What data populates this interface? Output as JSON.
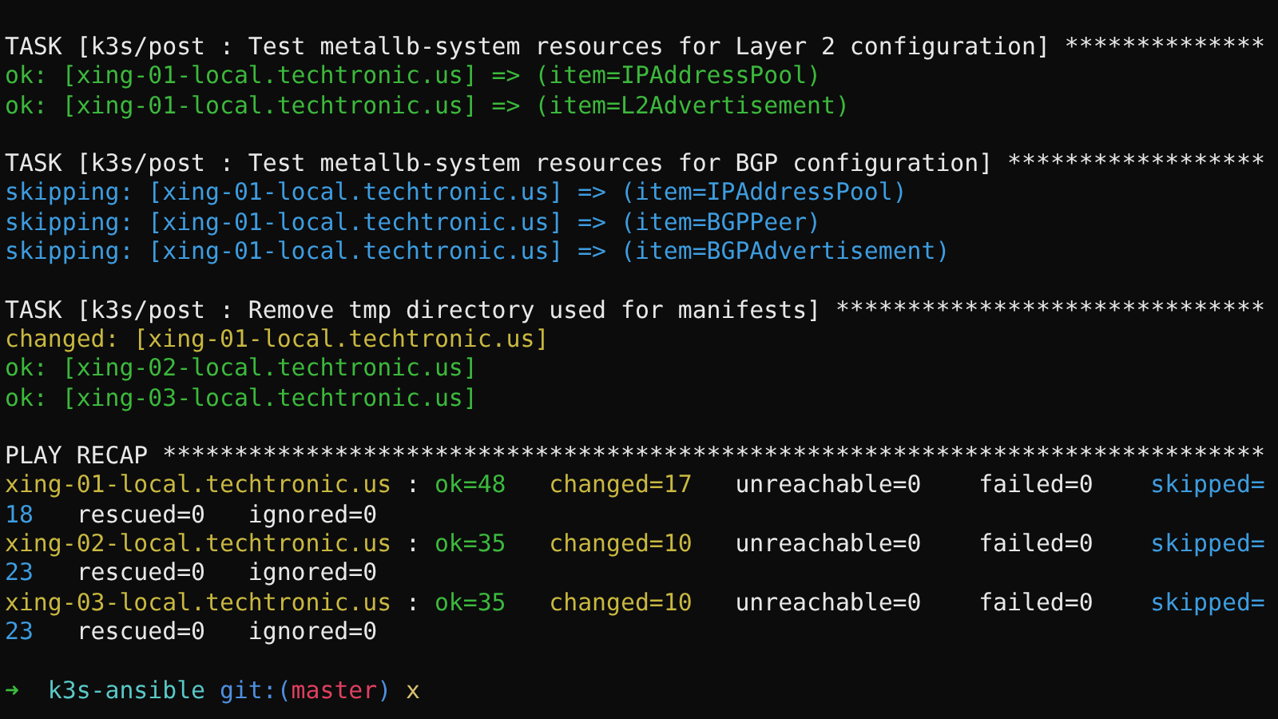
{
  "blocks": [
    {
      "lines": [
        {
          "kind": "text",
          "segments": [
            {
              "kind": "plain",
              "text": "TASK [k3s/post : Test metallb-system resources for Layer 2 configuration] **************"
            }
          ]
        },
        {
          "kind": "text",
          "segments": [
            {
              "kind": "ok",
              "text": "ok: [xing-01-local.techtronic.us] => (item=IPAddressPool)"
            }
          ]
        },
        {
          "kind": "text",
          "segments": [
            {
              "kind": "ok",
              "text": "ok: [xing-01-local.techtronic.us] => (item=L2Advertisement)"
            }
          ]
        }
      ]
    },
    {
      "lines": [
        {
          "kind": "text",
          "segments": [
            {
              "kind": "plain",
              "text": "TASK [k3s/post : Test metallb-system resources for BGP configuration] ******************"
            }
          ]
        },
        {
          "kind": "text",
          "segments": [
            {
              "kind": "skipping",
              "text": "skipping: [xing-01-local.techtronic.us] => (item=IPAddressPool)"
            }
          ]
        },
        {
          "kind": "text",
          "segments": [
            {
              "kind": "skipping",
              "text": "skipping: [xing-01-local.techtronic.us] => (item=BGPPeer)"
            }
          ]
        },
        {
          "kind": "text",
          "segments": [
            {
              "kind": "skipping",
              "text": "skipping: [xing-01-local.techtronic.us] => (item=BGPAdvertisement)"
            }
          ]
        }
      ]
    },
    {
      "lines": [
        {
          "kind": "text",
          "segments": [
            {
              "kind": "plain",
              "text": "TASK [k3s/post : Remove tmp directory used for manifests] ******************************"
            }
          ]
        },
        {
          "kind": "text",
          "segments": [
            {
              "kind": "changed",
              "text": "changed: [xing-01-local.techtronic.us]"
            }
          ]
        },
        {
          "kind": "text",
          "segments": [
            {
              "kind": "ok",
              "text": "ok: [xing-02-local.techtronic.us]"
            }
          ]
        },
        {
          "kind": "text",
          "segments": [
            {
              "kind": "ok",
              "text": "ok: [xing-03-local.techtronic.us]"
            }
          ]
        }
      ]
    },
    {
      "lines": [
        {
          "kind": "text",
          "segments": [
            {
              "kind": "plain",
              "text": "PLAY RECAP *****************************************************************************"
            }
          ]
        },
        {
          "kind": "recap",
          "segments": [
            {
              "kind": "changed",
              "text": "xing-01-local.techtronic.us"
            },
            {
              "kind": "plain",
              "text": ":"
            },
            {
              "kind": "ok",
              "text": "ok=48"
            },
            {
              "kind": "changed",
              "text": "changed=17"
            },
            {
              "kind": "plain",
              "text": "unreachable=0"
            },
            {
              "kind": "plain",
              "text": "failed=0"
            },
            {
              "kind": "skipping",
              "text": "skipped="
            }
          ]
        },
        {
          "kind": "continuation",
          "segments": [
            {
              "kind": "skipping",
              "text": "18"
            },
            {
              "kind": "plain",
              "text": "rescued=0"
            },
            {
              "kind": "plain",
              "text": "ignored=0"
            }
          ]
        },
        {
          "kind": "recap",
          "segments": [
            {
              "kind": "changed",
              "text": "xing-02-local.techtronic.us"
            },
            {
              "kind": "plain",
              "text": ":"
            },
            {
              "kind": "ok",
              "text": "ok=35"
            },
            {
              "kind": "changed",
              "text": "changed=10"
            },
            {
              "kind": "plain",
              "text": "unreachable=0"
            },
            {
              "kind": "plain",
              "text": "failed=0"
            },
            {
              "kind": "skipping",
              "text": "skipped="
            }
          ]
        },
        {
          "kind": "continuation",
          "segments": [
            {
              "kind": "skipping",
              "text": "23"
            },
            {
              "kind": "plain",
              "text": "rescued=0"
            },
            {
              "kind": "plain",
              "text": "ignored=0"
            }
          ]
        },
        {
          "kind": "recap",
          "segments": [
            {
              "kind": "changed",
              "text": "xing-03-local.techtronic.us"
            },
            {
              "kind": "plain",
              "text": ":"
            },
            {
              "kind": "ok",
              "text": "ok=35"
            },
            {
              "kind": "changed",
              "text": "changed=10"
            },
            {
              "kind": "plain",
              "text": "unreachable=0"
            },
            {
              "kind": "plain",
              "text": "failed=0"
            },
            {
              "kind": "skipping",
              "text": "skipped="
            }
          ]
        },
        {
          "kind": "continuation",
          "segments": [
            {
              "kind": "skipping",
              "text": "23"
            },
            {
              "kind": "plain",
              "text": "rescued=0"
            },
            {
              "kind": "plain",
              "text": "ignored=0"
            }
          ]
        }
      ]
    },
    {
      "lines": [
        {
          "kind": "prompt",
          "segments": [
            {
              "kind": "arrow",
              "text": "➜"
            },
            {
              "kind": "dir",
              "text": "k3s-ansible"
            },
            {
              "kind": "git",
              "text": "git:("
            },
            {
              "kind": "branch",
              "text": "master"
            },
            {
              "kind": "git",
              "text": ")"
            },
            {
              "kind": "dirty",
              "text": "x"
            }
          ]
        }
      ]
    }
  ]
}
